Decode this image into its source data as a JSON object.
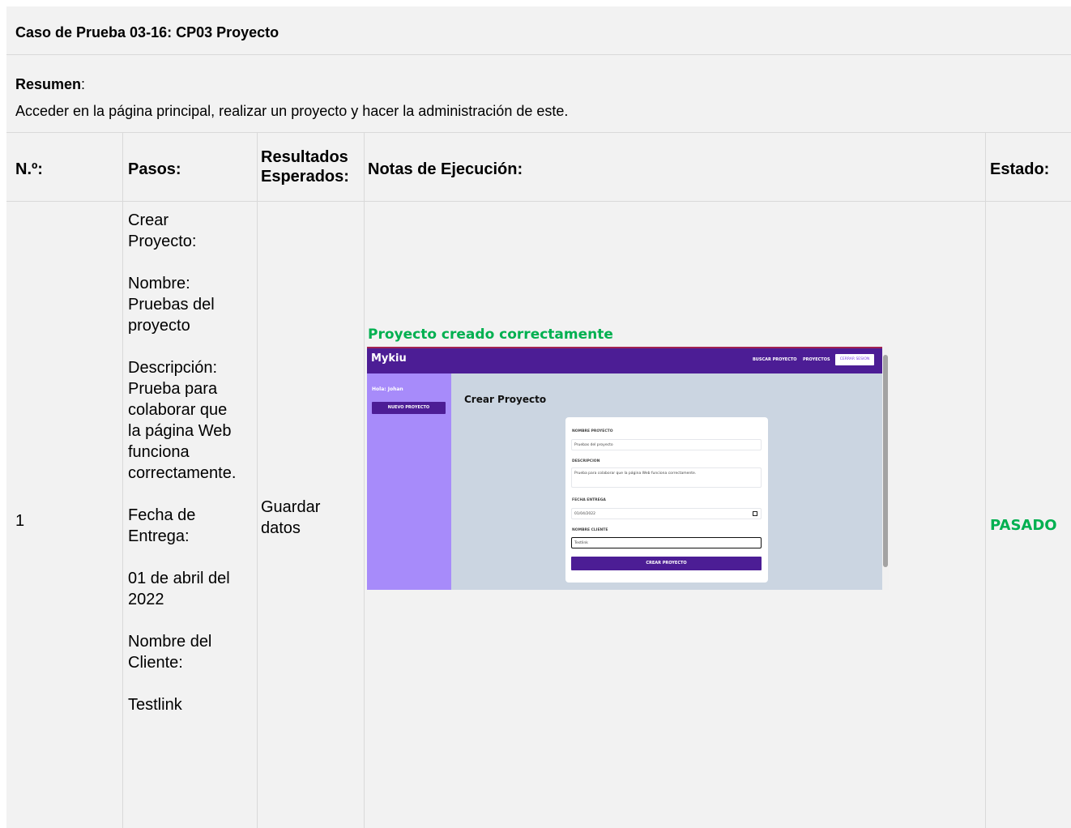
{
  "title": "Caso de Prueba 03-16: CP03 Proyecto",
  "resumen_label": "Resumen",
  "resumen_colon": ":",
  "resumen_text": "Acceder en la página principal, realizar un proyecto y hacer la administración de este.",
  "headers": {
    "num": "N.º:",
    "pasos": "Pasos:",
    "resultados_1": "Resultados",
    "resultados_2": "Esperados:",
    "notas": "Notas de Ejecución:",
    "estado": "Estado:"
  },
  "row": {
    "num": "1",
    "pasos": [
      "Crear",
      "Proyecto:",
      "",
      "Nombre:",
      "Pruebas del",
      "proyecto",
      "",
      "Descripción:",
      "Prueba para",
      "colaborar que",
      "la página Web",
      "funciona",
      "correctamente.",
      "",
      "Fecha de",
      "Entrega:",
      "",
      "01 de abril del",
      "2022",
      "",
      "Nombre del",
      "Cliente:",
      "",
      "Testlink"
    ],
    "resultados_1": "Guardar",
    "resultados_2": "datos",
    "status": "PASADO",
    "status_color": "#00b050"
  },
  "screenshot": {
    "caption": "Proyecto creado correctamente",
    "brand": "Mykiu",
    "nav": [
      "BUSCAR PROYECTO",
      "PROYECTOS"
    ],
    "logout": "CERRAR SESION",
    "greeting": "Hola: Johan",
    "new_project_button": "NUEVO PROYECTO",
    "heading": "Crear Proyecto",
    "form": {
      "name_label": "NOMBRE PROYECTO",
      "name_value": "Pruebas del proyecto",
      "desc_label": "DESCRIPCION",
      "desc_value": "Prueba para colaborar que la página Web funciona correctamente.",
      "date_label": "FECHA ENTREGA",
      "date_value": "01/04/2022",
      "client_label": "NOMBRE CLIENTE",
      "client_value": "Testlink",
      "submit": "CREAR PROYECTO"
    }
  }
}
